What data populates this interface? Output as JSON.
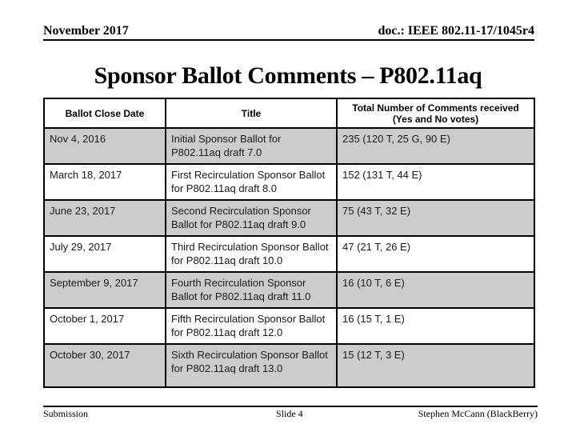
{
  "header": {
    "date": "November 2017",
    "doc_id": "doc.: IEEE 802.11-17/1045r4"
  },
  "slide_title": "Sponsor Ballot Comments – P802.11aq",
  "table": {
    "columns": [
      "Ballot Close Date",
      "Title",
      "Total Number of Comments received (Yes and No votes)"
    ],
    "rows": [
      {
        "date": "Nov 4, 2016",
        "title": "Initial Sponsor Ballot for P802.11aq draft 7.0",
        "comments": "235 (120 T, 25 G, 90 E)"
      },
      {
        "date": "March 18, 2017",
        "title": "First Recirculation Sponsor Ballot for P802.11aq draft 8.0",
        "comments": "152 (131 T, 44 E)"
      },
      {
        "date": "June 23, 2017",
        "title": "Second Recirculation Sponsor Ballot for P802.11aq draft 9.0",
        "comments": "75 (43 T, 32 E)"
      },
      {
        "date": "July 29, 2017",
        "title": "Third Recirculation Sponsor Ballot for P802.11aq draft 10.0",
        "comments": "47 (21 T, 26 E)"
      },
      {
        "date": "September 9, 2017",
        "title": "Fourth Recirculation Sponsor Ballot for P802.11aq draft 11.0",
        "comments": "16 (10 T, 6 E)"
      },
      {
        "date": "October 1, 2017",
        "title": "Fifth Recirculation Sponsor Ballot for P802.11aq draft 12.0",
        "comments": "16 (15 T, 1 E)"
      },
      {
        "date": "October 30, 2017",
        "title": "Sixth Recirculation Sponsor Ballot for P802.11aq draft 13.0",
        "comments": "15 (12 T, 3 E)"
      }
    ]
  },
  "footer": {
    "left": "Submission",
    "center": "Slide 4",
    "right": "Stephen McCann (BlackBerry)"
  },
  "colors": {
    "shaded_row": "#cccccc",
    "plain_row": "#ffffff",
    "border": "#000000"
  }
}
